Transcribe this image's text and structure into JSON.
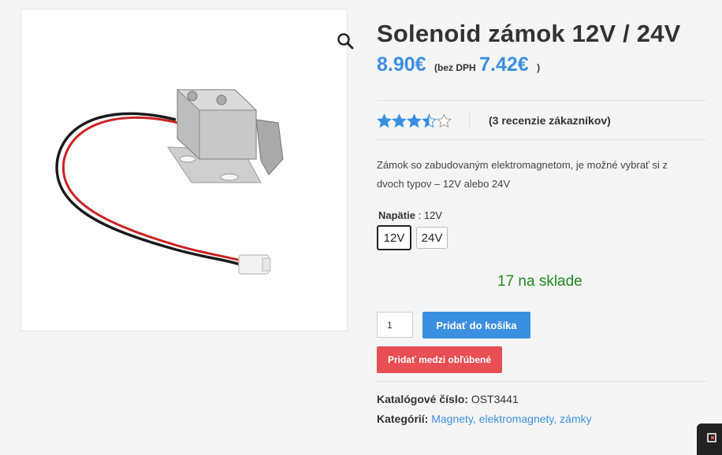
{
  "product": {
    "title": "Solenoid zámok 12V / 24V",
    "price": "8.90€",
    "vat_label": "(bez DPH",
    "vat_price": "7.42€",
    "vat_close": ")",
    "rating_value": 3.5,
    "rating_max": 5,
    "reviews_label": "(3 recenzie zákazníkov)",
    "description": "Zámok so zabudovaným elektromagnetom, je možné vybrať si z dvoch typov – 12V alebo 24V",
    "attribute": {
      "name": "Napätie",
      "separator": ":",
      "selected": "12V",
      "options": [
        "12V",
        "24V"
      ]
    },
    "stock": "17 na sklade",
    "quantity": "1",
    "add_to_cart": "Pridať do košíka",
    "add_to_wishlist": "Pridať medzi obľúbené",
    "sku_label": "Katalógové číslo:",
    "sku": "OST3441",
    "categories_label": "Kategórií:",
    "categories": [
      "Magnety",
      "elektromagnety",
      "zámky"
    ],
    "category_separator": ", "
  },
  "icons": {
    "zoom": "search-icon",
    "corner": "widget-icon"
  },
  "colors": {
    "price": "#3b8fe0",
    "cart_button": "#3b8fe0",
    "wishlist_button": "#e84e53",
    "stock": "#1e8a1e",
    "star": "#3b8fe0"
  }
}
